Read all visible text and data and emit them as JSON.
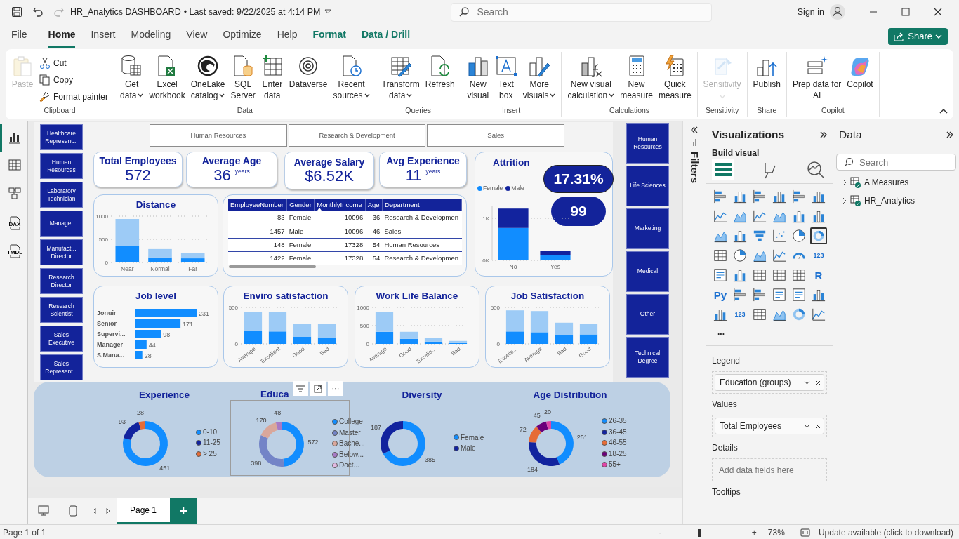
{
  "title_bar": {
    "file_name": "HR_Analytics DASHBOARD",
    "saved": "• Last saved: 9/22/2025 at 4:14 PM",
    "search_placeholder": "Search",
    "sign_in": "Sign in"
  },
  "menu": [
    {
      "label": "File",
      "selected": false,
      "kind": "plain"
    },
    {
      "label": "Home",
      "selected": true,
      "kind": "plain"
    },
    {
      "label": "Insert",
      "selected": false,
      "kind": "plain"
    },
    {
      "label": "Modeling",
      "selected": false,
      "kind": "plain"
    },
    {
      "label": "View",
      "selected": false,
      "kind": "plain"
    },
    {
      "label": "Optimize",
      "selected": false,
      "kind": "plain"
    },
    {
      "label": "Help",
      "selected": false,
      "kind": "plain"
    },
    {
      "label": "Format",
      "selected": false,
      "kind": "contextual"
    },
    {
      "label": "Data / Drill",
      "selected": false,
      "kind": "contextual"
    }
  ],
  "share": "Share",
  "ribbon": [
    {
      "label": "Clipboard",
      "buttons": [
        {
          "kind": "large",
          "lines": [
            "Paste"
          ],
          "disabled": true,
          "dropdown": false
        },
        {
          "kind": "small",
          "lines": [
            "Cut"
          ],
          "disabled": false,
          "dropdown": false
        },
        {
          "kind": "small",
          "lines": [
            "Copy"
          ],
          "disabled": false,
          "dropdown": false
        },
        {
          "kind": "small",
          "lines": [
            "Format painter"
          ],
          "disabled": false,
          "dropdown": false
        }
      ]
    },
    {
      "label": "Data",
      "buttons": [
        {
          "kind": "large",
          "lines": [
            "Get",
            "data"
          ],
          "disabled": false,
          "dropdown": true
        },
        {
          "kind": "large",
          "lines": [
            "Excel",
            "workbook"
          ],
          "disabled": false,
          "dropdown": false
        },
        {
          "kind": "large",
          "lines": [
            "OneLake",
            "catalog"
          ],
          "disabled": false,
          "dropdown": true
        },
        {
          "kind": "large",
          "lines": [
            "SQL",
            "Server"
          ],
          "disabled": false,
          "dropdown": false
        },
        {
          "kind": "large",
          "lines": [
            "Enter",
            "data"
          ],
          "disabled": false,
          "dropdown": false
        },
        {
          "kind": "large",
          "lines": [
            "Dataverse"
          ],
          "disabled": false,
          "dropdown": false
        },
        {
          "kind": "large",
          "lines": [
            "Recent",
            "sources"
          ],
          "disabled": false,
          "dropdown": true
        }
      ]
    },
    {
      "label": "Queries",
      "buttons": [
        {
          "kind": "large",
          "lines": [
            "Transform",
            "data"
          ],
          "disabled": false,
          "dropdown": true
        },
        {
          "kind": "large",
          "lines": [
            "Refresh"
          ],
          "disabled": false,
          "dropdown": false
        }
      ]
    },
    {
      "label": "Insert",
      "buttons": [
        {
          "kind": "large",
          "lines": [
            "New",
            "visual"
          ],
          "disabled": false,
          "dropdown": false
        },
        {
          "kind": "large",
          "lines": [
            "Text",
            "box"
          ],
          "disabled": false,
          "dropdown": false
        },
        {
          "kind": "large",
          "lines": [
            "More",
            "visuals"
          ],
          "disabled": false,
          "dropdown": true
        }
      ]
    },
    {
      "label": "Calculations",
      "buttons": [
        {
          "kind": "large",
          "lines": [
            "New visual",
            "calculation"
          ],
          "disabled": false,
          "dropdown": true
        },
        {
          "kind": "large",
          "lines": [
            "New",
            "measure"
          ],
          "disabled": false,
          "dropdown": false
        },
        {
          "kind": "large",
          "lines": [
            "Quick",
            "measure"
          ],
          "disabled": false,
          "dropdown": false
        }
      ]
    },
    {
      "label": "Sensitivity",
      "buttons": [
        {
          "kind": "large",
          "lines": [
            "Sensitivity"
          ],
          "disabled": true,
          "dropdown": true
        }
      ]
    },
    {
      "label": "Share",
      "buttons": [
        {
          "kind": "large",
          "lines": [
            "Publish"
          ],
          "disabled": false,
          "dropdown": false
        }
      ]
    },
    {
      "label": "Copilot",
      "buttons": [
        {
          "kind": "large",
          "lines": [
            "Prep data for",
            "AI"
          ],
          "disabled": false,
          "dropdown": false
        },
        {
          "kind": "large",
          "lines": [
            "Copilot"
          ],
          "disabled": false,
          "dropdown": false
        }
      ]
    }
  ],
  "views": [
    {
      "selected": true
    },
    {
      "selected": false
    },
    {
      "selected": false
    },
    {
      "selected": false,
      "label": "DAX"
    },
    {
      "selected": false,
      "label": "TMDL"
    }
  ],
  "report": {
    "role_slicer": [
      "Healthcare Represent...",
      "Human Resources",
      "Laboratory Technician",
      "Manager",
      "Manufact... Director",
      "Research Director",
      "Research Scientist",
      "Sales Executive",
      "Sales Represent..."
    ],
    "department_slicer": [
      "Human Resources",
      "Research & Development",
      "Sales"
    ],
    "education_slicer": [
      "Human Resources",
      "Life Sciences",
      "Marketing",
      "Medical",
      "Other",
      "Technical Degree"
    ],
    "cards": [
      {
        "title": "Total Employees",
        "value": "572"
      },
      {
        "title": "Average Age",
        "value": "36",
        "unit": "years"
      },
      {
        "title": "Average Salary",
        "value": "$6.52K"
      },
      {
        "title": "Avg Experience",
        "value": "11",
        "unit": "years"
      }
    ],
    "attrition": {
      "title": "Attrition",
      "rate": "17.31%",
      "count": "99",
      "chart_data": {
        "type": "bar",
        "categories": [
          "No",
          "Yes"
        ],
        "stacked": true,
        "ylim": [
          0,
          1300
        ],
        "yticks": [
          {
            "value": 0,
            "label": "0K"
          },
          {
            "value": 1000,
            "label": "1K"
          }
        ],
        "series": [
          {
            "name": "Female",
            "color": "#118dff",
            "values": [
              770,
              120
            ]
          },
          {
            "name": "Male",
            "color": "#12239e",
            "values": [
              460,
              110
            ]
          }
        ]
      }
    },
    "distance": {
      "chart_data": {
        "type": "bar",
        "title": "Distance",
        "categories": [
          "Near",
          "Normal",
          "Far"
        ],
        "stacked": true,
        "ylim": [
          0,
          1000
        ],
        "yticks": [
          0,
          500,
          1000
        ],
        "series": [
          {
            "color": "#118dff",
            "values": [
              350,
              110,
              90
            ]
          },
          {
            "color": "#9dcbf6",
            "values": [
              590,
              180,
              120
            ]
          }
        ]
      }
    },
    "table": {
      "columns": [
        {
          "label": "EmployeeNumber",
          "sorted": false
        },
        {
          "label": "Gender",
          "sorted": false
        },
        {
          "label": "MonthlyIncome",
          "sorted": true
        },
        {
          "label": "Age",
          "sorted": false
        },
        {
          "label": "Department",
          "sorted": false
        }
      ],
      "rows": [
        [
          "83",
          "Female",
          "10096",
          "36",
          "Research & Developmen"
        ],
        [
          "1457",
          "Male",
          "10096",
          "46",
          "Sales"
        ],
        [
          "148",
          "Female",
          "17328",
          "54",
          "Human Resources"
        ],
        [
          "1422",
          "Female",
          "17328",
          "54",
          "Research & Developmen"
        ]
      ]
    },
    "job_level": {
      "chart_data": {
        "type": "bar",
        "orientation": "horizontal",
        "title": "Job level",
        "categories": [
          "Jonuir",
          "Senior",
          "Supervi...",
          "Manager",
          "S.Mana..."
        ],
        "values": [
          231,
          171,
          98,
          44,
          28
        ],
        "value_labels": [
          "231",
          "171",
          "98",
          "44",
          "28"
        ]
      }
    },
    "satisfaction_charts": [
      {
        "chart_data": {
          "type": "bar",
          "title": "Enviro satisfaction",
          "categories": [
            "Average",
            "Excellent",
            "Good",
            "Bad"
          ],
          "stacked": true,
          "ylim": [
            0,
            500
          ],
          "yticks": [
            0,
            500
          ],
          "series": [
            {
              "color": "#118dff",
              "values": [
                180,
                170,
                100,
                90
              ]
            },
            {
              "color": "#9dcbf6",
              "values": [
                260,
                270,
                170,
                180
              ]
            }
          ]
        }
      },
      {
        "chart_data": {
          "type": "bar",
          "title": "Work Life Balance",
          "categories": [
            "Average",
            "Good",
            "Excelle...",
            "Bad"
          ],
          "stacked": true,
          "ylim": [
            0,
            1000
          ],
          "yticks": [
            0,
            500,
            1000
          ],
          "series": [
            {
              "color": "#118dff",
              "values": [
                330,
                140,
                60,
                20
              ]
            },
            {
              "color": "#9dcbf6",
              "values": [
                550,
                190,
                100,
                60
              ]
            }
          ]
        }
      },
      {
        "chart_data": {
          "type": "bar",
          "title": "Job Satisfaction",
          "categories": [
            "Excelle...",
            "Average",
            "Bad",
            "Good"
          ],
          "stacked": true,
          "ylim": [
            0,
            500
          ],
          "yticks": [
            0,
            500
          ],
          "series": [
            {
              "color": "#118dff",
              "values": [
                170,
                160,
                120,
                130
              ]
            },
            {
              "color": "#9dcbf6",
              "values": [
                290,
                290,
                170,
                140
              ]
            }
          ]
        }
      }
    ],
    "donuts": [
      {
        "slices": [
          {
            "color": "#118dff"
          },
          {
            "color": "#12239e"
          },
          {
            "color": "#e66c37"
          }
        ],
        "chart_data": {
          "type": "donut",
          "title": "Experience",
          "categories": [
            "0-10",
            "11-25",
            "> 25"
          ],
          "values": [
            451,
            93,
            28
          ],
          "value_labels": [
            "451",
            "93",
            "28"
          ]
        }
      },
      {
        "slices": [
          {
            "color": "#118dff"
          },
          {
            "color": "#7384c7"
          },
          {
            "color": "#d9a79b"
          },
          {
            "color": "#a77ac5"
          },
          {
            "color": "#e2b9e2"
          }
        ],
        "chart_data": {
          "type": "donut",
          "title": "Educa",
          "categories": [
            "College",
            "Master",
            "Bache...",
            "Below...",
            "Doct..."
          ],
          "values": [
            572,
            398,
            170,
            48,
            null
          ],
          "value_labels": [
            "572",
            "398",
            "170",
            "48",
            null
          ]
        }
      },
      {
        "slices": [
          {
            "color": "#118dff"
          },
          {
            "color": "#12239e"
          }
        ],
        "chart_data": {
          "type": "donut",
          "title": "Diversity",
          "categories": [
            "Female",
            "Male"
          ],
          "values": [
            385,
            187
          ],
          "value_labels": [
            "385",
            "187"
          ]
        }
      },
      {
        "slices": [
          {
            "color": "#118dff"
          },
          {
            "color": "#12239e"
          },
          {
            "color": "#e66c37"
          },
          {
            "color": "#6b007b"
          },
          {
            "color": "#e044a7"
          }
        ],
        "chart_data": {
          "type": "donut",
          "title": "Age Distribution",
          "categories": [
            "26-35",
            "36-45",
            "46-55",
            "18-25",
            "55+"
          ],
          "values": [
            251,
            184,
            72,
            45,
            20
          ],
          "value_labels": [
            "251",
            "184",
            "72",
            "45",
            "20"
          ]
        }
      }
    ],
    "visual_header": {
      "more": "···"
    }
  },
  "filters": {
    "label": "Filters"
  },
  "visualizations": {
    "title": "Visualizations",
    "build_label": "Build visual",
    "build_tabs": [
      {
        "selected": true
      },
      {
        "selected": false
      },
      {
        "selected": false
      }
    ],
    "gallery": [
      {
        "selected": false
      },
      {
        "selected": false
      },
      {
        "selected": false
      },
      {
        "selected": false
      },
      {
        "selected": false
      },
      {
        "selected": false
      },
      {
        "selected": false
      },
      {
        "selected": false
      },
      {
        "selected": false
      },
      {
        "selected": false
      },
      {
        "selected": false
      },
      {
        "selected": false
      },
      {
        "selected": false
      },
      {
        "selected": false
      },
      {
        "selected": false
      },
      {
        "selected": false
      },
      {
        "selected": false
      },
      {
        "selected": true
      },
      {
        "selected": false
      },
      {
        "selected": false
      },
      {
        "selected": false
      },
      {
        "selected": false
      },
      {
        "selected": false
      },
      {
        "selected": false,
        "label": "123"
      },
      {
        "selected": false
      },
      {
        "selected": false
      },
      {
        "selected": false
      },
      {
        "selected": false
      },
      {
        "selected": false
      },
      {
        "selected": false,
        "label": "R"
      },
      {
        "selected": false,
        "label": "Py"
      },
      {
        "selected": false
      },
      {
        "selected": false
      },
      {
        "selected": false
      },
      {
        "selected": false
      },
      {
        "selected": false
      },
      {
        "selected": false
      },
      {
        "selected": false,
        "label": "123"
      },
      {
        "selected": false
      },
      {
        "selected": false
      },
      {
        "selected": false
      },
      {
        "selected": false
      }
    ],
    "more": "...",
    "wells": [
      {
        "label": "Legend",
        "field": "Education (groups)"
      },
      {
        "label": "Values",
        "field": "Total Employees"
      },
      {
        "label": "Details",
        "placeholder": "Add data fields here"
      },
      {
        "label": "Tooltips"
      }
    ]
  },
  "data_pane": {
    "title": "Data",
    "search_placeholder": "Search",
    "tables": [
      {
        "name": "A Measures",
        "expanded": false
      },
      {
        "name": "HR_Analytics",
        "expanded": false
      }
    ]
  },
  "pages": [
    {
      "label": "Page 1",
      "selected": true
    }
  ],
  "add_page": "+",
  "status": {
    "page_info": "Page 1 of 1",
    "zoom_minus": "-",
    "zoom_plus": "+",
    "zoom": {
      "level": 0.4
    },
    "zoom_text": "73%",
    "update": "Update available (click to download)"
  }
}
